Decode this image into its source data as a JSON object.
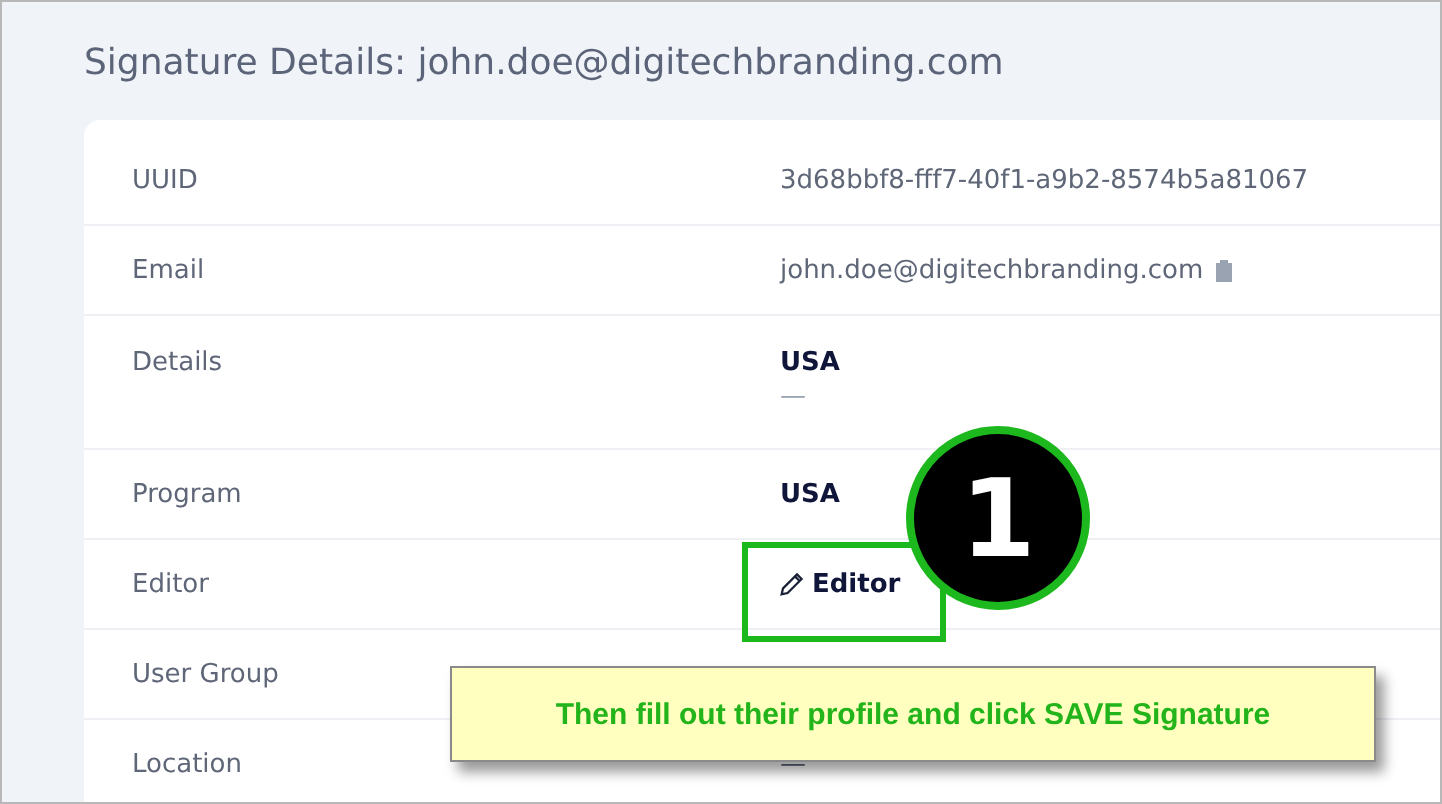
{
  "title": "Signature Details: john.doe@digitechbranding.com",
  "rows": [
    {
      "label": "UUID",
      "kind": "text",
      "value": "3d68bbf8-fff7-40f1-a9b2-8574b5a81067"
    },
    {
      "label": "Email",
      "kind": "copy",
      "value": "john.doe@digitechbranding.com"
    },
    {
      "label": "Details",
      "kind": "bold",
      "value": "USA",
      "note": "—"
    },
    {
      "label": "Program",
      "kind": "bold",
      "value": "USA"
    },
    {
      "label": "Editor",
      "kind": "button",
      "value": "Editor"
    },
    {
      "label": "User Group",
      "kind": "empty"
    },
    {
      "label": "Location",
      "kind": "text",
      "value": "—"
    }
  ],
  "annotation": {
    "step": "1",
    "callout": "Then fill out their profile and click SAVE Signature"
  }
}
